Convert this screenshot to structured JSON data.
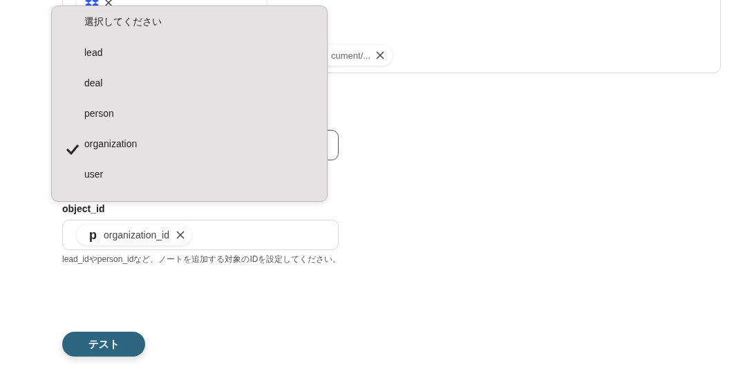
{
  "attachments_field": {
    "chips": [
      {
        "kind": "dropbox"
      },
      {
        "kind": "plain",
        "text": "cument/..."
      }
    ]
  },
  "object_type_field": {
    "kind": "select"
  },
  "object_id_field": {
    "label": "object_id",
    "chip": {
      "icon": "p",
      "text": "organization_id"
    },
    "help": "lead_idやperson_idなど、ノートを追加する対象のIDを設定してください。"
  },
  "test_button": "テスト",
  "dropdown": {
    "options": [
      {
        "label": "選択してください",
        "selected": false
      },
      {
        "label": "lead",
        "selected": false
      },
      {
        "label": "deal",
        "selected": false
      },
      {
        "label": "person",
        "selected": false
      },
      {
        "label": "organization",
        "selected": true
      },
      {
        "label": "user",
        "selected": false
      }
    ]
  }
}
